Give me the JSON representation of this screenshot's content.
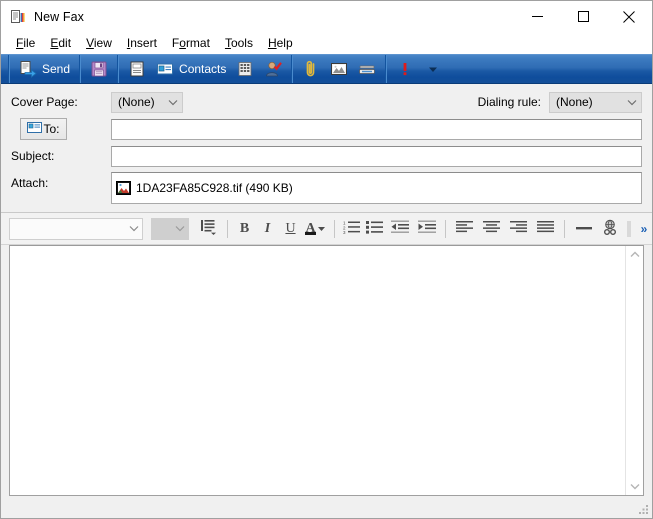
{
  "window": {
    "title": "New Fax",
    "icon": "fax-document-icon",
    "controls": {
      "minimize": "Minimize",
      "maximize": "Maximize",
      "close": "Close"
    }
  },
  "menubar": {
    "items": [
      {
        "label": "File",
        "accel": "F"
      },
      {
        "label": "Edit",
        "accel": "E"
      },
      {
        "label": "View",
        "accel": "V"
      },
      {
        "label": "Insert",
        "accel": "I"
      },
      {
        "label": "Format",
        "accel": "o"
      },
      {
        "label": "Tools",
        "accel": "T"
      },
      {
        "label": "Help",
        "accel": "H"
      }
    ]
  },
  "toolbar": {
    "send_label": "Send",
    "contacts_label": "Contacts",
    "buttons": [
      {
        "name": "send-button",
        "icon": "send-fax-icon"
      },
      {
        "name": "save-button",
        "icon": "floppy-disk-icon"
      },
      {
        "name": "print-button",
        "icon": "printer-icon"
      },
      {
        "name": "contacts-button",
        "icon": "address-card-icon"
      },
      {
        "name": "dial-pad-button",
        "icon": "keypad-icon"
      },
      {
        "name": "check-names-button",
        "icon": "person-check-icon"
      },
      {
        "name": "attach-file-button",
        "icon": "paperclip-icon"
      },
      {
        "name": "insert-picture-button",
        "icon": "picture-icon"
      },
      {
        "name": "scan-button",
        "icon": "scanner-icon"
      },
      {
        "name": "priority-button",
        "icon": "red-exclamation-icon"
      },
      {
        "name": "toolbar-overflow-button",
        "icon": "chevron-down-icon"
      }
    ]
  },
  "fields": {
    "cover_page_label": "Cover Page:",
    "cover_page_value": "(None)",
    "dialing_rule_label": "Dialing rule:",
    "dialing_rule_value": "(None)",
    "to_label": "To:",
    "to_value": "",
    "to_placeholder": "",
    "subject_label": "Subject:",
    "subject_value": "",
    "subject_placeholder": "",
    "attach_label": "Attach:",
    "attachment_name": "1DA23FA85C928.tif (490 KB)",
    "attachment_icon": "image-file-icon"
  },
  "format_toolbar": {
    "font_name": "",
    "font_size": "",
    "buttons": [
      {
        "name": "paragraph-style-button",
        "icon": "paragraph-icon"
      },
      {
        "name": "bold-button",
        "icon": "bold-icon",
        "glyph": "B"
      },
      {
        "name": "italic-button",
        "icon": "italic-icon",
        "glyph": "I"
      },
      {
        "name": "underline-button",
        "icon": "underline-icon",
        "glyph": "U"
      },
      {
        "name": "font-color-button",
        "icon": "font-color-icon",
        "glyph": "A"
      },
      {
        "name": "numbered-list-button",
        "icon": "numbered-list-icon"
      },
      {
        "name": "bulleted-list-button",
        "icon": "bulleted-list-icon"
      },
      {
        "name": "decrease-indent-button",
        "icon": "decrease-indent-icon"
      },
      {
        "name": "increase-indent-button",
        "icon": "increase-indent-icon"
      },
      {
        "name": "align-left-button",
        "icon": "align-left-icon"
      },
      {
        "name": "align-center-button",
        "icon": "align-center-icon"
      },
      {
        "name": "align-right-button",
        "icon": "align-right-icon"
      },
      {
        "name": "justify-button",
        "icon": "align-justify-icon"
      },
      {
        "name": "horizontal-rule-button",
        "icon": "horizontal-rule-icon"
      },
      {
        "name": "insert-hyperlink-button",
        "icon": "hyperlink-globe-icon"
      }
    ],
    "overflow_label": "»"
  },
  "editor": {
    "body_text": "",
    "scrollbar": {
      "up_arrow": "scroll-up-icon",
      "down_arrow": "scroll-down-icon"
    }
  },
  "statusbar": {
    "resize_grip": "resize-grip-icon"
  }
}
